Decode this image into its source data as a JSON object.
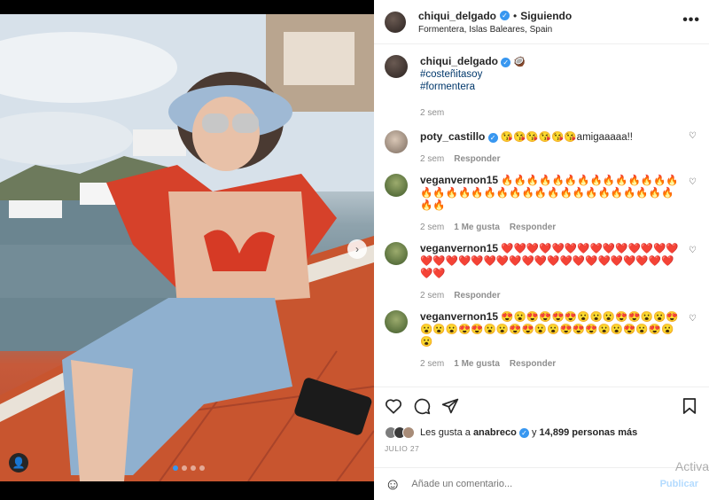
{
  "post": {
    "author": "chiqui_delgado",
    "follow_status": "Siguiendo",
    "location": "Formentera, Islas Baleares, Spain",
    "more": "•••"
  },
  "caption": {
    "author": "chiqui_delgado",
    "emoji": "🥥",
    "tags": [
      "#costeñitasoy",
      "#formentera"
    ],
    "time": "2 sem"
  },
  "comments": [
    {
      "user": "poty_castillo",
      "verified": true,
      "text": "😘😘😘😘😘😘amigaaaaa!!",
      "time": "2 sem",
      "likes": "",
      "reply": "Responder"
    },
    {
      "user": "veganvernon15",
      "verified": false,
      "text": "🔥🔥🔥🔥🔥🔥🔥🔥🔥🔥🔥🔥🔥🔥🔥🔥🔥🔥🔥🔥🔥🔥🔥🔥🔥🔥🔥🔥🔥🔥🔥🔥🔥🔥🔥🔥",
      "time": "2 sem",
      "likes": "1 Me gusta",
      "reply": "Responder"
    },
    {
      "user": "veganvernon15",
      "verified": false,
      "text": "❤️❤️❤️❤️❤️❤️❤️❤️❤️❤️❤️❤️❤️❤️❤️❤️❤️❤️❤️❤️❤️❤️❤️❤️❤️❤️❤️❤️❤️❤️❤️❤️❤️❤️❤️❤️",
      "time": "2 sem",
      "likes": "",
      "reply": "Responder"
    },
    {
      "user": "veganvernon15",
      "verified": false,
      "text": "😍😮😍😍😍😍😮😮😮😍😍😮😮😍😮😮😮😍😍😮😮😍😍😮😮😍😍😍😮😮😍😮😍😮😮",
      "time": "2 sem",
      "likes": "1 Me gusta",
      "reply": "Responder"
    }
  ],
  "likes": {
    "prefix": "Les gusta a",
    "user": "anabreco",
    "joiner": "y",
    "others": "14,899 personas más"
  },
  "date": "JULIO 27",
  "add_comment": {
    "placeholder": "Añade un comentario...",
    "publish": "Publicar"
  },
  "watermark": "Activa",
  "colors": {
    "accent": "#3897f0",
    "hashtag": "#00376b",
    "muted": "#8e8e8e"
  }
}
